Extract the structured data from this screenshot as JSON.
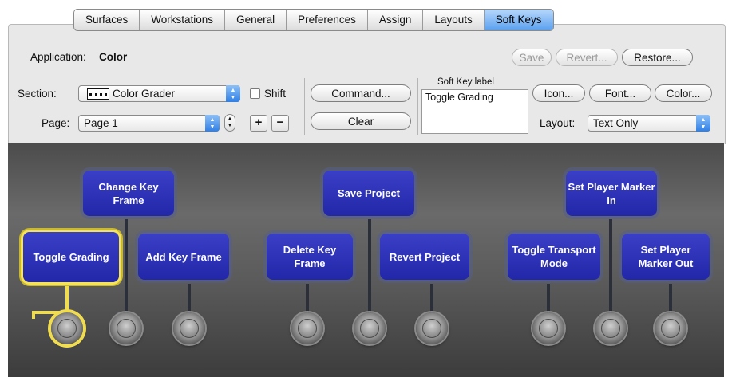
{
  "tabs": [
    "Surfaces",
    "Workstations",
    "General",
    "Preferences",
    "Assign",
    "Layouts",
    "Soft Keys"
  ],
  "application": {
    "label": "Application:",
    "value": "Color"
  },
  "buttons": {
    "save": "Save",
    "revert": "Revert...",
    "restore": "Restore...",
    "command": "Command...",
    "clear": "Clear",
    "icon": "Icon...",
    "font": "Font...",
    "color": "Color...",
    "plus": "+",
    "minus": "−"
  },
  "section": {
    "label": "Section:",
    "value": "Color Grader",
    "shift_label": "Shift",
    "shift_checked": false
  },
  "page": {
    "label": "Page:",
    "value": "Page 1"
  },
  "soft_key_label": {
    "title": "Soft Key label",
    "value": "Toggle Grading"
  },
  "layout": {
    "label": "Layout:",
    "value": "Text Only"
  },
  "softkeys": [
    "Toggle Grading",
    "Change Key Frame",
    "Add Key Frame",
    "Delete Key Frame",
    "Save Project",
    "Revert Project",
    "Toggle Transport Mode",
    "Set Player Marker In",
    "Set Player Marker Out"
  ],
  "colors": {
    "accent": "#5aa0ef",
    "softkey": "#2a2fb5",
    "selection": "#f0dc50"
  }
}
